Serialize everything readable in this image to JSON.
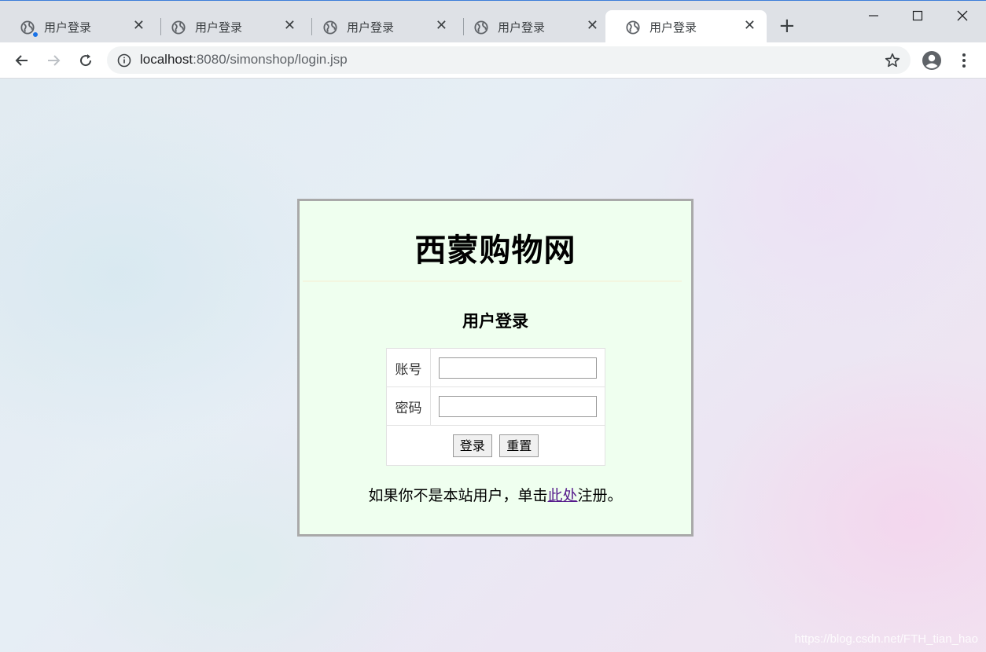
{
  "browser": {
    "tabs": [
      {
        "title": "用户登录",
        "active": false,
        "loading_dot": true
      },
      {
        "title": "用户登录",
        "active": false
      },
      {
        "title": "用户登录",
        "active": false
      },
      {
        "title": "用户登录",
        "active": false
      },
      {
        "title": "用户登录",
        "active": true
      }
    ],
    "tab_close_glyph": "✕",
    "new_tab_glyph": "+",
    "url_host": "localhost",
    "url_rest": ":8080/simonshop/login.jsp"
  },
  "page": {
    "site_title": "西蒙购物网",
    "form_title": "用户登录",
    "account_label": "账号",
    "password_label": "密码",
    "account_value": "",
    "password_value": "",
    "login_button": "登录",
    "reset_button": "重置",
    "register_prefix": "如果你不是本站用户，单击",
    "register_link": "此处",
    "register_suffix": "注册。"
  },
  "watermark": "https://blog.csdn.net/FTH_tian_hao",
  "colors": {
    "card_bg": "#efffef",
    "card_border": "#a9a9a9",
    "link": "#551a8b",
    "tabbar": "#dee1e6",
    "accent": "#1a73e8"
  }
}
